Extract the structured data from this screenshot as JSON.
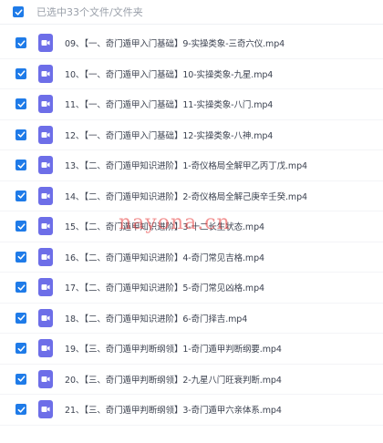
{
  "header": {
    "selection_text": "已选中33个文件/文件夹"
  },
  "files": [
    {
      "name": "09、【一、奇门遁甲入门基础】9-实操类象-三奇六仪.mp4"
    },
    {
      "name": "10、【一、奇门遁甲入门基础】10-实操类象-九星.mp4"
    },
    {
      "name": "11、【一、奇门遁甲入门基础】11-实操类象-八门.mp4"
    },
    {
      "name": "12、【一、奇门遁甲入门基础】12-实操类象-八神.mp4"
    },
    {
      "name": "13、【二、奇门遁甲知识进阶】1-奇仪格局全解甲乙丙丁戊.mp4"
    },
    {
      "name": "14、【二、奇门遁甲知识进阶】2-奇仪格局全解己庚辛壬癸.mp4"
    },
    {
      "name": "15、【二、奇门遁甲知识进阶】3-十二长生状态.mp4"
    },
    {
      "name": "16、【二、奇门遁甲知识进阶】4-奇门常见吉格.mp4"
    },
    {
      "name": "17、【二、奇门遁甲知识进阶】5-奇门常见凶格.mp4"
    },
    {
      "name": "18、【二、奇门遁甲知识进阶】6-奇门择吉.mp4"
    },
    {
      "name": "19、【三、奇门遁甲判断纲领】1-奇门遁甲判断纲要.mp4"
    },
    {
      "name": "20、【三、奇门遁甲判断纲领】2-九星八门旺衰判断.mp4"
    },
    {
      "name": "21、【三、奇门遁甲判断纲领】3-奇门遁甲六亲体系.mp4"
    }
  ],
  "watermark": "nayona.cn",
  "colors": {
    "checkbox": "#1f7be8",
    "video_icon": "#6d6ee8",
    "watermark": "#e83c3c"
  },
  "icons": {
    "checkbox": "checkmark-icon",
    "file": "video-file-icon"
  }
}
